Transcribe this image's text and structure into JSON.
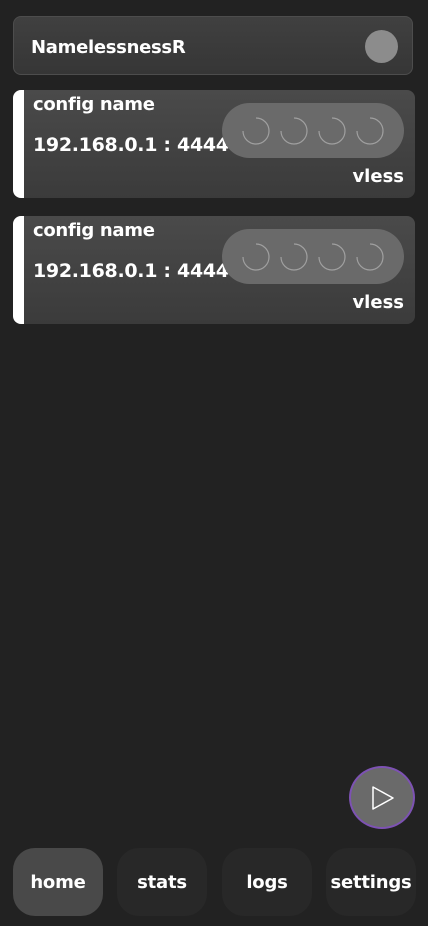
{
  "profile": {
    "name": "NamelessnessR"
  },
  "configs": [
    {
      "name": "config name",
      "address": "192.168.0.1 : 4444",
      "protocol": "vless"
    },
    {
      "name": "config name",
      "address": "192.168.0.1 : 4444",
      "protocol": "vless"
    }
  ],
  "nav": {
    "home": "home",
    "stats": "stats",
    "logs": "logs",
    "settings": "settings",
    "active": "home"
  },
  "icons": {
    "profile_status": "status-dot-icon",
    "ping": "loading-spinner-icon",
    "fab": "play-icon"
  },
  "colors": {
    "background": "#222222",
    "card": "#444444",
    "accent_stripe": "#ffffff",
    "fab_border": "#7d52b3",
    "status_dot": "#8c8c8c"
  }
}
